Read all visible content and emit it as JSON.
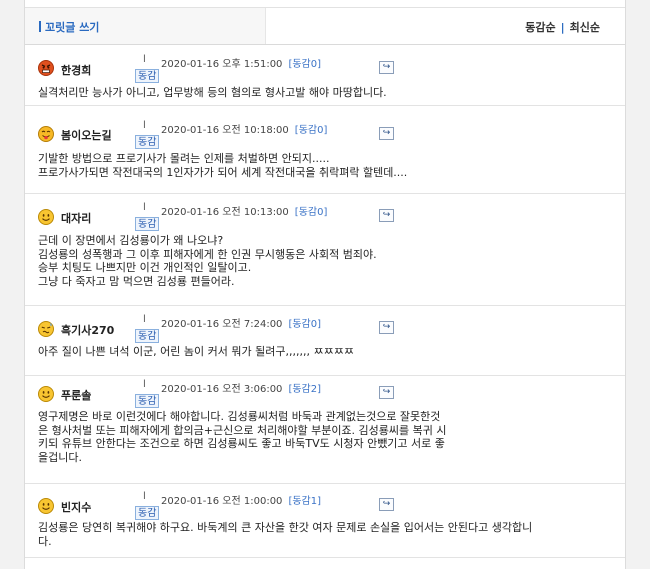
{
  "header": {
    "write_label": "꼬릿글 쓰기",
    "sort_likes": "동감순",
    "sort_sep": "|",
    "sort_latest": "최신순"
  },
  "colors": {
    "accent": "#2a6ac0",
    "agree": "#3a72c6"
  },
  "reply_icon": "arrow-reply-icon",
  "comments": [
    {
      "nick": "한경희",
      "emoticon": "angry-face-icon",
      "bar": "l",
      "date": "2020-01-16 오후 1:51:00",
      "agree": "[동감0]",
      "agree_btn": "동감",
      "text": "실격처리만 능사가 아니고, 업무방해 등의 혐의로 형사고발 해야 마땅합니다."
    },
    {
      "nick": "봄이오는길",
      "emoticon": "tongue-face-icon",
      "bar": "l",
      "date": "2020-01-16 오전 10:18:00",
      "agree": "[동감0]",
      "agree_btn": "동감",
      "text": "기발한 방법으로 프로기사가 몰려는 인제를 처벌하면 안되지.....\n프로가사가되면 작전대국의 1인자가가 되어 세계 작전대국을 취락펴락 할텐데...."
    },
    {
      "nick": "대자리",
      "emoticon": "smile-face-icon",
      "bar": "l",
      "date": "2020-01-16 오전 10:13:00",
      "agree": "[동감0]",
      "agree_btn": "동감",
      "text": "근데 이 장면에서 김성룡이가 왜 나오냐?\n김성룡의 성폭행과 그 이후 피해자에게 한 인권 무시행동은 사회적 범죄야.\n승부 치팅도 나쁘지만 이건 개인적인 일탈이고.\n그냥 다 죽자고 맘 먹으면 김성룡 편들어라."
    },
    {
      "nick": "흑기사270",
      "emoticon": "confused-face-icon",
      "bar": "l",
      "date": "2020-01-16 오전 7:24:00",
      "agree": "[동감0]",
      "agree_btn": "동감",
      "text": "아주 질이 나쁜 녀석 이군, 어린 놈이 커서 뭐가 될려구,,,,,,, ㅉㅉㅉㅉ"
    },
    {
      "nick": "푸룬솔",
      "emoticon": "smile-face-icon",
      "bar": "l",
      "date": "2020-01-16 오전 3:06:00",
      "agree": "[동감2]",
      "agree_btn": "동감",
      "text": "영구제명은 바로 이런것에다 해야합니다. 김성룡씨처럼 바둑과 관계없는것으로 잘못한것\n은 형사처벌 또는 피해자에게 합의금+근신으로 처리해야할 부분이죠. 김성룡씨를 복귀 시\n키되 유튜브 안한다는 조건으로 하면 김성룡씨도 좋고 바둑TV도 시청자 안뺐기고 서로 좋\n을겁니다."
    },
    {
      "nick": "빈지수",
      "emoticon": "smile-face-icon",
      "bar": "l",
      "date": "2020-01-16 오전 1:00:00",
      "agree": "[동감1]",
      "agree_btn": "동감",
      "text": "김성룡은 당연히 복귀해야 하구요. 바둑계의 큰 자산을 한갓 여자 문제로 손실을 입어서는 안된다고 생각합니\n다."
    }
  ]
}
